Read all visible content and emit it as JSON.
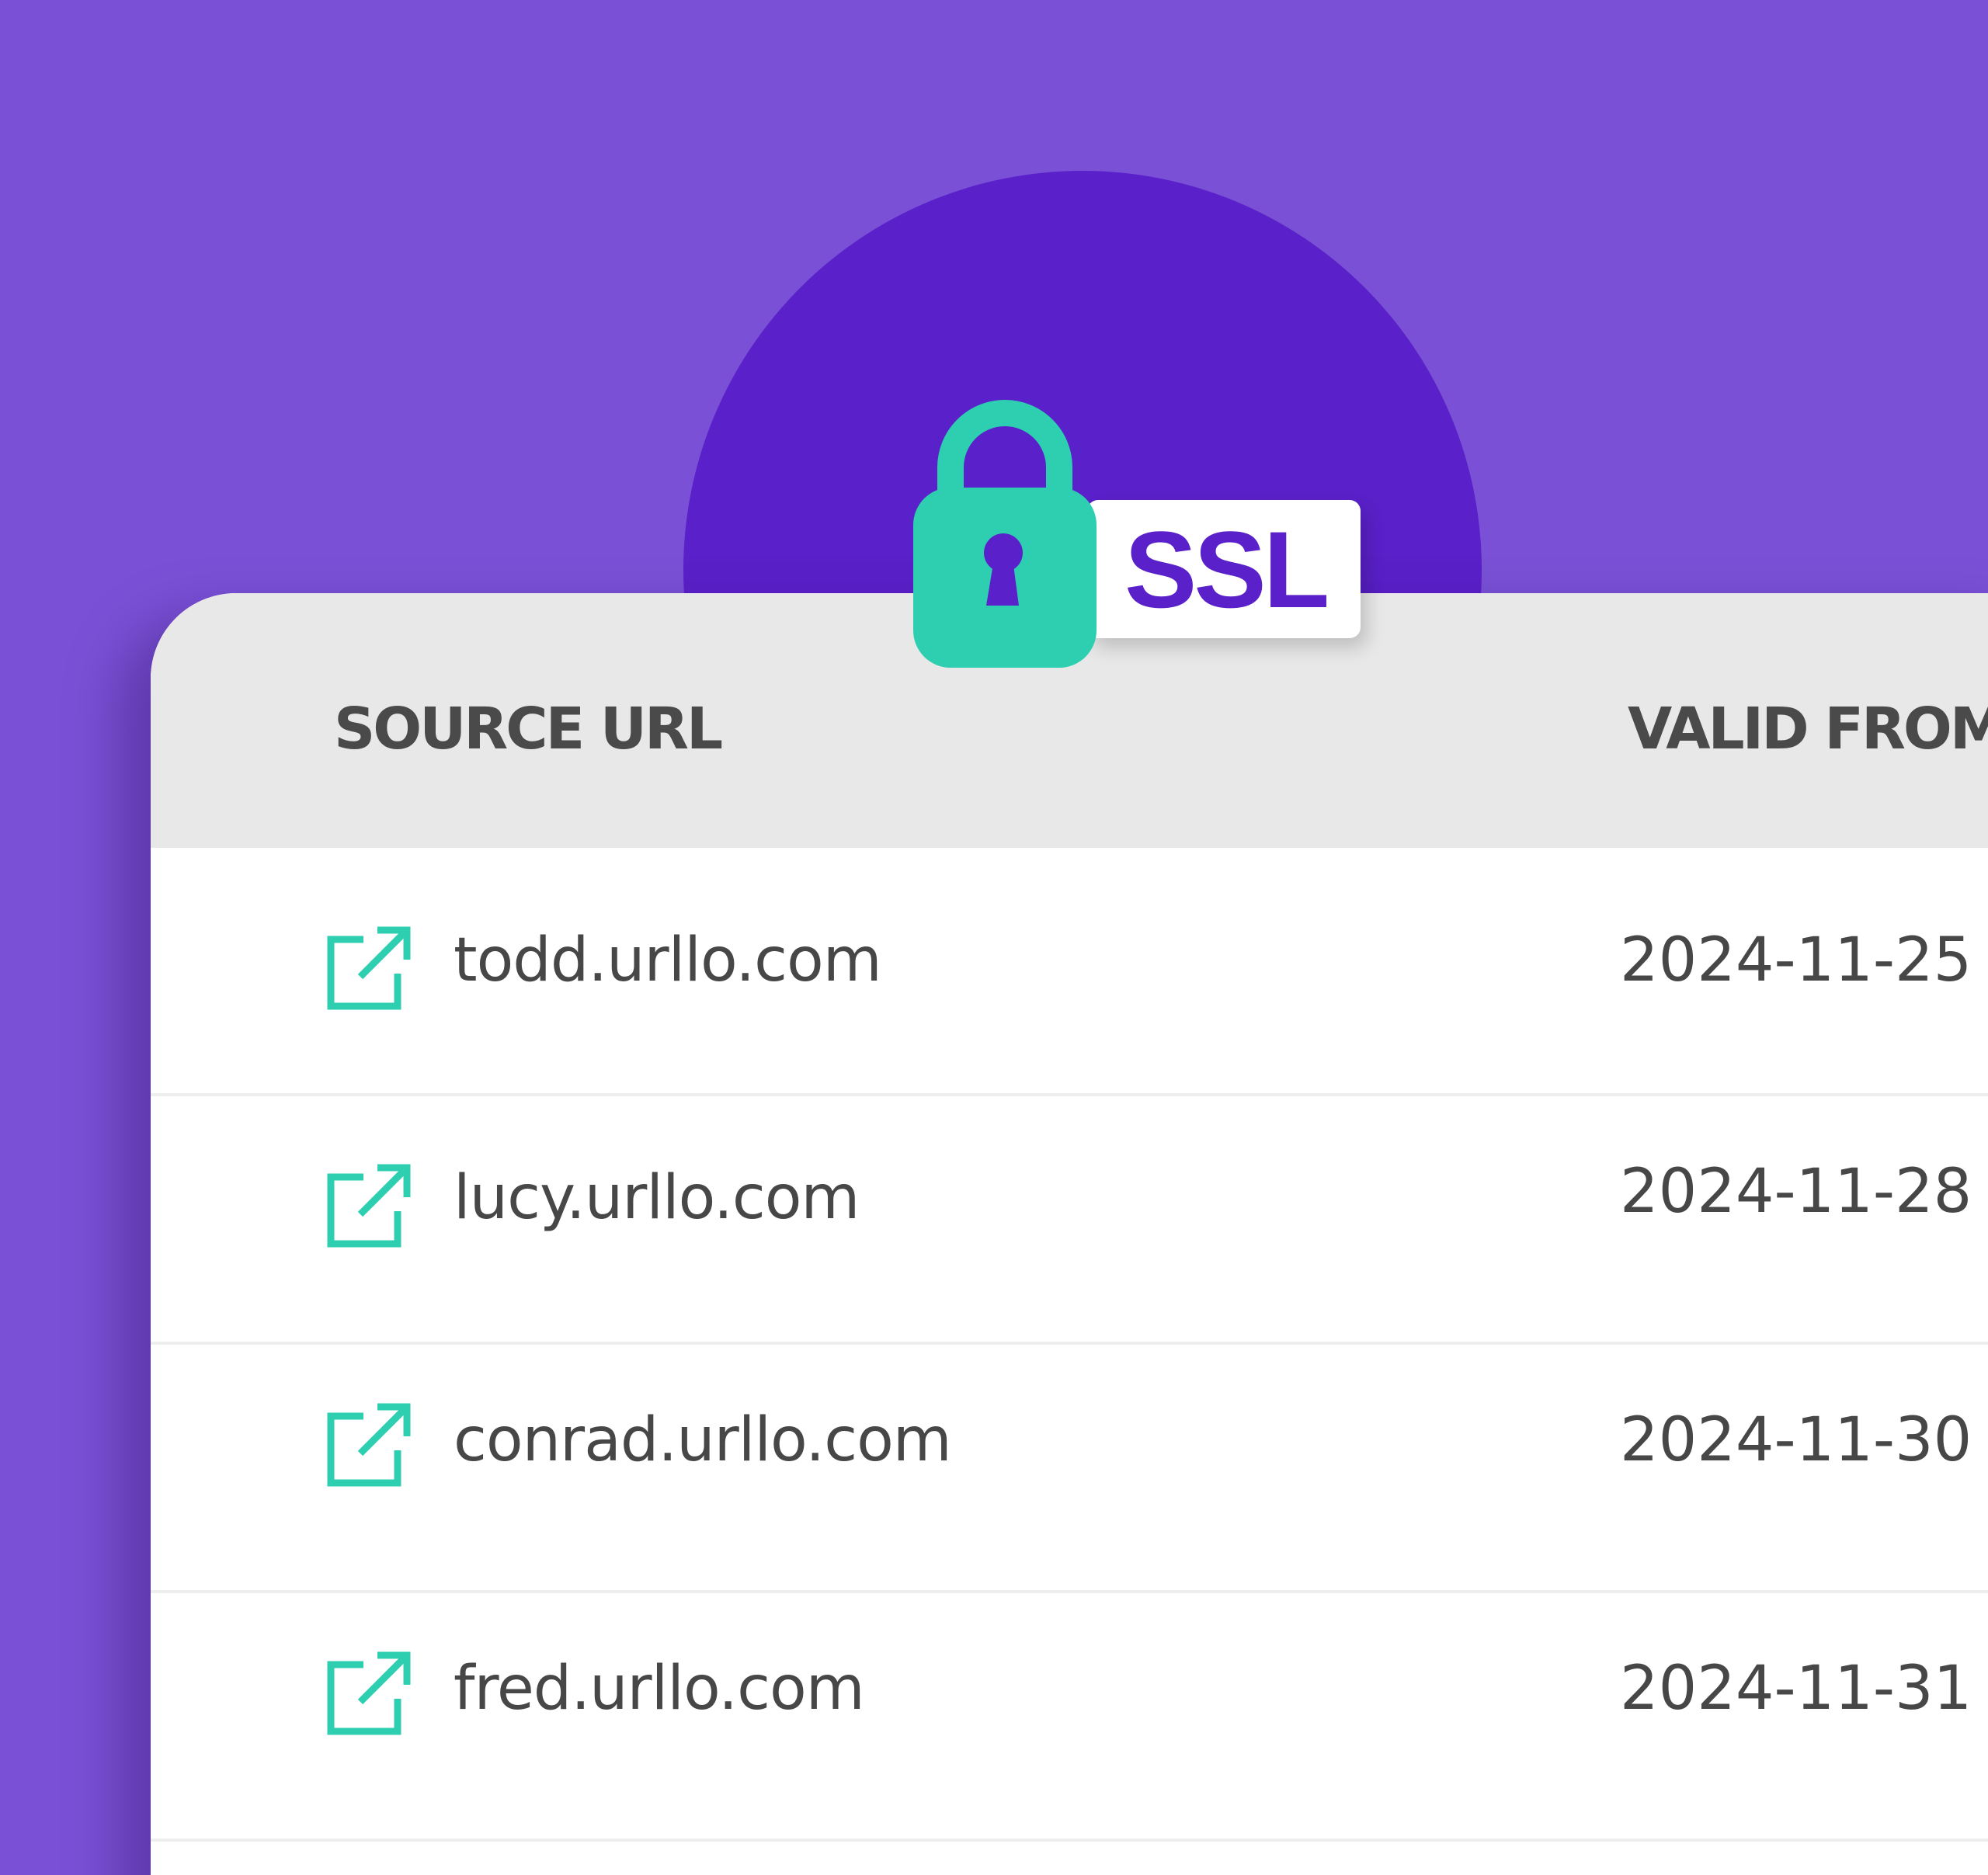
{
  "badge": {
    "label": "SSL"
  },
  "table": {
    "columns": [
      "SOURCE URL",
      "VALID FROM"
    ],
    "rows": [
      {
        "url": "todd.urllo.com",
        "valid_from": "2024-11-25"
      },
      {
        "url": "lucy.urllo.com",
        "valid_from": "2024-11-28"
      },
      {
        "url": "conrad.urllo.com",
        "valid_from": "2024-11-30"
      },
      {
        "url": "fred.urllo.com",
        "valid_from": "2024-11-31"
      }
    ]
  },
  "colors": {
    "background": "#7a51d6",
    "circle": "#5a20c9",
    "accent_teal": "#2ecfb1",
    "header_bg": "#e8e8e8",
    "text": "#474747"
  },
  "icons": {
    "lock": "padlock-icon",
    "row_link": "external-link-icon"
  }
}
